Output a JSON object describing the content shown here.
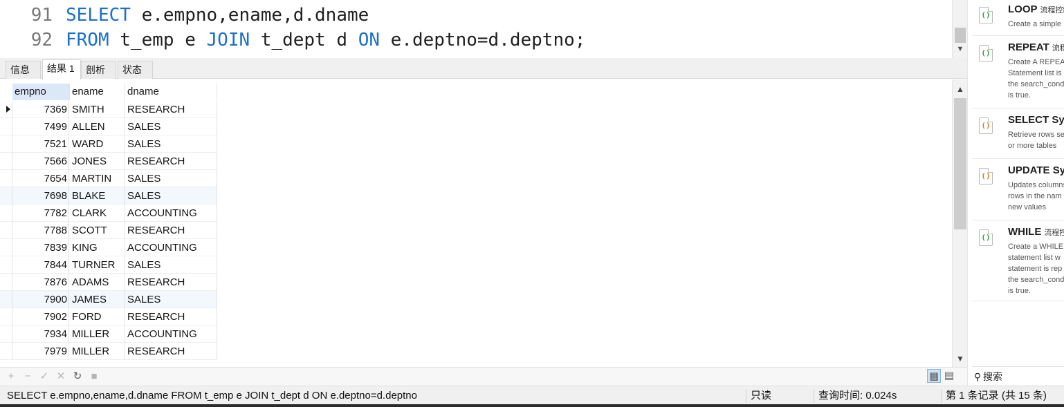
{
  "editor": {
    "lines": [
      {
        "num": "91",
        "parts": [
          {
            "t": "SELECT",
            "k": true
          },
          {
            "t": " e.empno,ename,d.dname",
            "k": false
          }
        ]
      },
      {
        "num": "92",
        "parts": [
          {
            "t": "FROM",
            "k": true
          },
          {
            "t": " t_emp e ",
            "k": false
          },
          {
            "t": "JOIN",
            "k": true
          },
          {
            "t": " t_dept d ",
            "k": false
          },
          {
            "t": "ON",
            "k": true
          },
          {
            "t": " e.deptno=d.deptno;",
            "k": false
          }
        ]
      }
    ]
  },
  "tabs": [
    {
      "label": "信息",
      "active": false
    },
    {
      "label": "结果 1",
      "active": true
    },
    {
      "label": "剖析",
      "active": false
    },
    {
      "label": "状态",
      "active": false
    }
  ],
  "grid": {
    "columns": [
      "empno",
      "ename",
      "dname"
    ],
    "rows": [
      [
        "7369",
        "SMITH",
        "RESEARCH"
      ],
      [
        "7499",
        "ALLEN",
        "SALES"
      ],
      [
        "7521",
        "WARD",
        "SALES"
      ],
      [
        "7566",
        "JONES",
        "RESEARCH"
      ],
      [
        "7654",
        "MARTIN",
        "SALES"
      ],
      [
        "7698",
        "BLAKE",
        "SALES"
      ],
      [
        "7782",
        "CLARK",
        "ACCOUNTING"
      ],
      [
        "7788",
        "SCOTT",
        "RESEARCH"
      ],
      [
        "7839",
        "KING",
        "ACCOUNTING"
      ],
      [
        "7844",
        "TURNER",
        "SALES"
      ],
      [
        "7876",
        "ADAMS",
        "RESEARCH"
      ],
      [
        "7900",
        "JAMES",
        "SALES"
      ],
      [
        "7902",
        "FORD",
        "RESEARCH"
      ],
      [
        "7934",
        "MILLER",
        "ACCOUNTING"
      ],
      [
        "7979",
        "MILLER",
        "RESEARCH"
      ]
    ]
  },
  "toolbar": {
    "add": "+",
    "remove": "−",
    "apply": "✓",
    "discard": "✕",
    "refresh": "↻",
    "stop": "■",
    "grid_view_icon": "▦",
    "form_view_icon": "▤"
  },
  "status": {
    "sql": "SELECT e.empno,ename,d.dname FROM t_emp e JOIN t_dept d ON e.deptno=d.deptno",
    "mode": "只读",
    "query_time": "查询时间: 0.024s",
    "record": "第 1 条记录 (共 15 条)"
  },
  "snippets": [
    {
      "title": "LOOP",
      "tag": "流程控制",
      "desc": "Create a simple",
      "icon": "green"
    },
    {
      "title": "REPEAT",
      "tag": "流程控制",
      "desc": "Create A REPEAT\nStatement list is\nthe search_cond\nis true.",
      "icon": "green"
    },
    {
      "title": "SELECT Syn",
      "tag": "",
      "desc": "Retrieve rows se\nor more tables",
      "icon": "orange"
    },
    {
      "title": "UPDATE Syn",
      "tag": "",
      "desc": "Updates columns\nrows in the nam\nnew values",
      "icon": "orange"
    },
    {
      "title": "WHILE",
      "tag": "流程控制",
      "desc": "Create a WHILE\nstatement list w\nstatement is rep\nthe search_cond\nis true.",
      "icon": "green"
    }
  ],
  "search": {
    "label": "搜索"
  }
}
